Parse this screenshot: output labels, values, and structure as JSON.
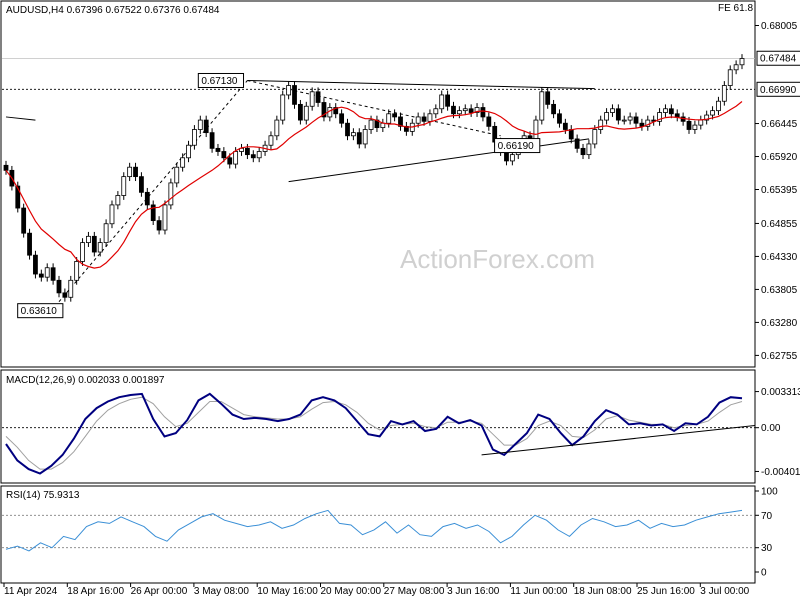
{
  "symbol_title": "AUDUSD,H4  0.67396 0.67522 0.67376 0.67484",
  "fib_label": "FE 61.8",
  "watermark": "ActionForex.com",
  "colors": {
    "candle": "#000000",
    "ma": "#e00000",
    "macd": "#000080",
    "signal": "#a0a0a0",
    "rsi": "#3a8fd6",
    "watermark": "#d0d0d0"
  },
  "chart_data": [
    {
      "type": "candlestick",
      "title": "AUDUSD,H4",
      "ohlc_last": {
        "open": 0.67396,
        "high": 0.67522,
        "low": 0.67376,
        "close": 0.67484
      },
      "y_ticks": [
        "0.68005",
        "0.67484",
        "0.66990",
        "0.66445",
        "0.65920",
        "0.65395",
        "0.64855",
        "0.64330",
        "0.63805",
        "0.63280",
        "0.62755"
      ],
      "ylim": [
        0.6265,
        0.6822
      ],
      "reference_lines": [
        {
          "value": 0.6699,
          "label": "0.66990",
          "style": "dotted"
        }
      ],
      "annotations": [
        {
          "label": "0.63610",
          "value": 0.6361
        },
        {
          "label": "0.67130",
          "value": 0.6713
        },
        {
          "label": "0.66190",
          "value": 0.6619
        }
      ],
      "current_price_label": "0.67484",
      "close_series": [
        0.657,
        0.6545,
        0.651,
        0.647,
        0.6435,
        0.6405,
        0.64,
        0.6415,
        0.6395,
        0.6375,
        0.6368,
        0.6395,
        0.6425,
        0.6455,
        0.6465,
        0.644,
        0.6455,
        0.6485,
        0.6515,
        0.653,
        0.656,
        0.6575,
        0.656,
        0.6535,
        0.6515,
        0.649,
        0.6475,
        0.6515,
        0.655,
        0.6575,
        0.659,
        0.661,
        0.6635,
        0.665,
        0.663,
        0.6605,
        0.66,
        0.659,
        0.658,
        0.66,
        0.6605,
        0.6595,
        0.659,
        0.66,
        0.661,
        0.6625,
        0.665,
        0.669,
        0.6705,
        0.6675,
        0.665,
        0.6672,
        0.6695,
        0.6678,
        0.6655,
        0.667,
        0.666,
        0.6645,
        0.6625,
        0.663,
        0.6612,
        0.6635,
        0.665,
        0.6638,
        0.6645,
        0.666,
        0.6655,
        0.664,
        0.6632,
        0.6645,
        0.6655,
        0.6648,
        0.666,
        0.6668,
        0.669,
        0.6672,
        0.666,
        0.6665,
        0.6668,
        0.6662,
        0.667,
        0.6655,
        0.664,
        0.6615,
        0.66,
        0.6585,
        0.6595,
        0.661,
        0.6625,
        0.662,
        0.665,
        0.6695,
        0.6675,
        0.666,
        0.6645,
        0.6635,
        0.662,
        0.6605,
        0.6595,
        0.6612,
        0.6635,
        0.665,
        0.6662,
        0.6668,
        0.665,
        0.665,
        0.6655,
        0.6645,
        0.664,
        0.665,
        0.6648,
        0.6662,
        0.6668,
        0.666,
        0.6655,
        0.6648,
        0.6635,
        0.6642,
        0.665,
        0.6658,
        0.6665,
        0.668,
        0.6705,
        0.673,
        0.6738,
        0.6748
      ]
    },
    {
      "type": "line",
      "title": "MACD(12,26,9) 0.002033 0.001897",
      "y_ticks": [
        "0.003313",
        "0.00",
        "-0.004016"
      ],
      "ylim": [
        -0.0048,
        0.0041
      ],
      "series": [
        {
          "name": "MACD",
          "values": [
            -0.0015,
            -0.003,
            -0.0038,
            -0.0042,
            -0.0035,
            -0.0025,
            -0.001,
            0.0008,
            0.0018,
            0.0024,
            0.0028,
            0.003,
            0.0031,
            0.0008,
            -0.0008,
            -0.0005,
            0.0007,
            0.0025,
            0.0031,
            0.0022,
            0.0012,
            0.0008,
            0.0009,
            0.0008,
            0.0006,
            0.0008,
            0.0012,
            0.0025,
            0.0028,
            0.0025,
            0.0018,
            0.0006,
            -0.0006,
            -0.0008,
            0.0006,
            0.0003,
            0.0006,
            -0.0003,
            -0.0001,
            0.001,
            0.0004,
            0.0007,
            0.0002,
            -0.002,
            -0.0025,
            -0.0015,
            -0.0005,
            0.0012,
            0.0008,
            -0.0005,
            -0.0016,
            -0.0008,
            0.0006,
            0.0016,
            0.0012,
            0.0003,
            0.0004,
            0.0002,
            0.0003,
            -0.0003,
            0.0004,
            0.0003,
            0.001,
            0.0023,
            0.0028,
            0.0027
          ]
        },
        {
          "name": "Signal",
          "values": [
            -0.0008,
            -0.0018,
            -0.003,
            -0.0038,
            -0.0038,
            -0.0032,
            -0.0022,
            -0.0008,
            0.0006,
            0.0016,
            0.0022,
            0.0026,
            0.0028,
            0.0022,
            0.001,
            0.0001,
            0.0004,
            0.0014,
            0.0024,
            0.0024,
            0.0018,
            0.0012,
            0.001,
            0.0009,
            0.0008,
            0.0008,
            0.001,
            0.0017,
            0.0023,
            0.0024,
            0.0021,
            0.0014,
            0.0004,
            -0.0002,
            0.0002,
            0.0003,
            0.0004,
            0.0001,
            0.0,
            0.0005,
            0.0005,
            0.0006,
            0.0004,
            -0.0006,
            -0.0016,
            -0.0016,
            -0.001,
            0.0002,
            0.0006,
            0.0002,
            -0.0008,
            -0.0009,
            -0.0002,
            0.0008,
            0.0011,
            0.0007,
            0.0005,
            0.0003,
            0.0003,
            0.0,
            0.0002,
            0.0003,
            0.0006,
            0.0014,
            0.0021,
            0.0024
          ]
        }
      ]
    },
    {
      "type": "line",
      "title": "RSI(14) 75.9313",
      "y_ticks": [
        "100",
        "70",
        "30",
        "0"
      ],
      "ylim": [
        0,
        100
      ],
      "series": [
        {
          "name": "RSI(14)",
          "values": [
            28,
            32,
            26,
            36,
            30,
            44,
            40,
            56,
            62,
            60,
            68,
            62,
            56,
            44,
            38,
            52,
            60,
            68,
            72,
            64,
            60,
            56,
            58,
            62,
            54,
            58,
            66,
            72,
            76,
            60,
            58,
            46,
            52,
            62,
            48,
            58,
            46,
            44,
            56,
            60,
            54,
            58,
            50,
            36,
            44,
            58,
            70,
            64,
            52,
            44,
            58,
            66,
            62,
            56,
            58,
            64,
            54,
            60,
            56,
            58,
            64,
            68,
            72,
            74,
            76
          ]
        }
      ]
    }
  ],
  "x_labels": [
    "11 Apr 2024",
    "18 Apr 16:00",
    "26 Apr 00:00",
    "3 May 08:00",
    "10 May 16:00",
    "20 May 00:00",
    "27 May 08:00",
    "3 Jun 16:00",
    "11 Jun 00:00",
    "18 Jun 08:00",
    "25 Jun 16:00",
    "3 Jul 00:00"
  ]
}
